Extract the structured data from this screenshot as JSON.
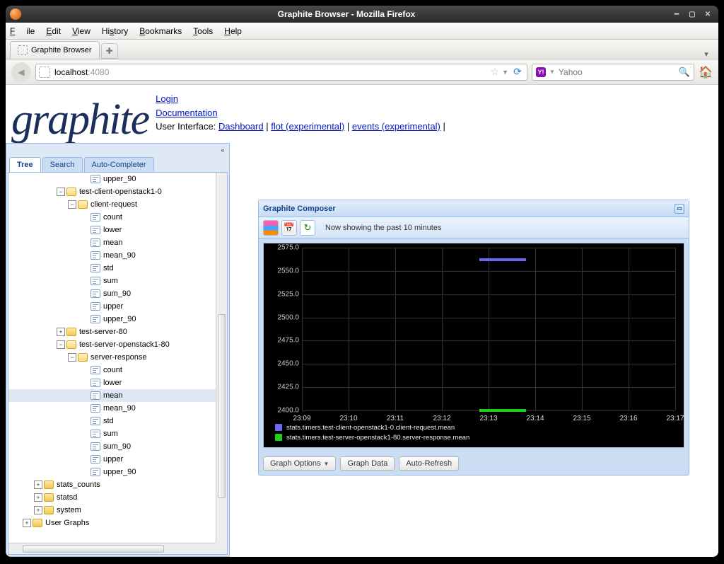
{
  "window": {
    "title": "Graphite Browser - Mozilla Firefox"
  },
  "menubar": {
    "file": "File",
    "edit": "Edit",
    "view": "View",
    "history": "History",
    "bookmarks": "Bookmarks",
    "tools": "Tools",
    "help": "Help"
  },
  "tabs": {
    "active": "Graphite Browser"
  },
  "url": {
    "host": "localhost",
    "port": ":4080"
  },
  "search": {
    "provider": "Y!",
    "placeholder": "Yahoo"
  },
  "header": {
    "logo": "graphite",
    "login": "Login",
    "docs": "Documentation",
    "ui_label": "User Interface: ",
    "dashboard": "Dashboard",
    "flot": "flot (experimental)",
    "events": "events (experimental)"
  },
  "sidebar": {
    "tabs": {
      "tree": "Tree",
      "search": "Search",
      "auto": "Auto-Completer"
    },
    "nodes": {
      "upper90a": "upper_90",
      "tc_os10": "test-client-openstack1-0",
      "client_req": "client-request",
      "count": "count",
      "lower": "lower",
      "mean": "mean",
      "mean90": "mean_90",
      "std": "std",
      "sum": "sum",
      "sum90": "sum_90",
      "upper": "upper",
      "upper90": "upper_90",
      "ts80": "test-server-80",
      "ts_os180": "test-server-openstack1-80",
      "server_resp": "server-response",
      "count2": "count",
      "lower2": "lower",
      "mean2": "mean",
      "mean902": "mean_90",
      "std2": "std",
      "sum2": "sum",
      "sum902": "sum_90",
      "upper2": "upper",
      "upper902": "upper_90",
      "stats_counts": "stats_counts",
      "statsd": "statsd",
      "system": "system",
      "user_graphs": "User Graphs"
    }
  },
  "composer": {
    "title": "Graphite Composer",
    "status": "Now showing the past 10 minutes",
    "buttons": {
      "options": "Graph Options",
      "data": "Graph Data",
      "refresh": "Auto-Refresh"
    }
  },
  "chart_data": {
    "type": "line",
    "title": "",
    "xlabel": "",
    "ylabel": "",
    "ylim": [
      2400,
      2575
    ],
    "yticks": [
      2400,
      2425,
      2450,
      2475,
      2500,
      2525,
      2550,
      2575
    ],
    "xticks": [
      "23:09",
      "23:10",
      "23:11",
      "23:12",
      "23:13",
      "23:14",
      "23:15",
      "23:16",
      "23:17"
    ],
    "series": [
      {
        "name": "stats.timers.test-client-openstack1-0.client-request.mean",
        "color": "#6a6af0",
        "segments": [
          {
            "x0": "23:12.8",
            "x1": "23:13.8",
            "y": 2562
          }
        ]
      },
      {
        "name": "stats.timers.test-server-openstack1-80.server-response.mean",
        "color": "#1ecf1e",
        "segments": [
          {
            "x0": "23:12.8",
            "x1": "23:13.8",
            "y": 2400
          }
        ]
      }
    ]
  }
}
